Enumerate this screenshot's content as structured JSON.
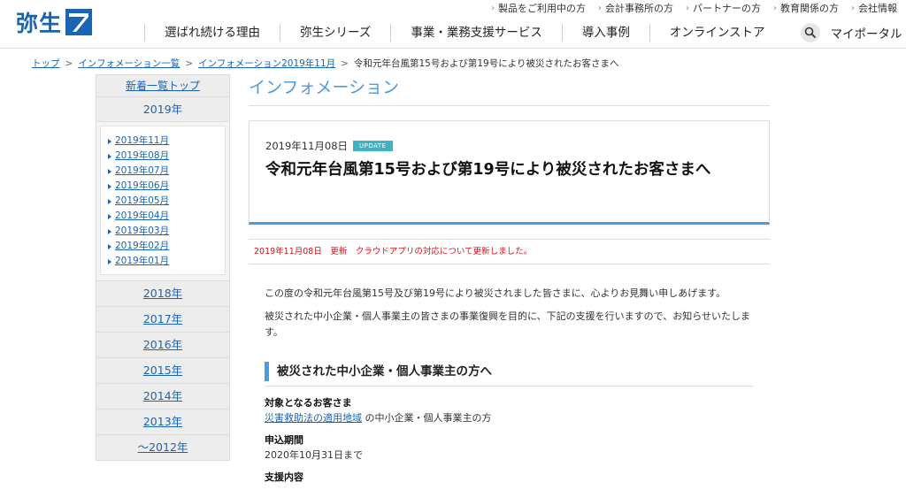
{
  "header": {
    "logo_text": "弥生",
    "utility_links": [
      "製品をご利用中の方",
      "会計事務所の方",
      "パートナーの方",
      "教育関係の方",
      "会社情報"
    ],
    "nav": [
      "選ばれ続ける理由",
      "弥生シリーズ",
      "事業・業務支援サービス",
      "導入事例",
      "オンラインストア"
    ],
    "myportal": "マイポータル"
  },
  "breadcrumb": {
    "items": [
      "トップ",
      "インフォメーション一覧",
      "インフォメーション2019年11月"
    ],
    "current": "令和元年台風第15号および第19号により被災されたお客さまへ"
  },
  "sidebar": {
    "top_link": "新着一覧トップ",
    "current_year": "2019年",
    "months": [
      "2019年11月",
      "2019年08月",
      "2019年07月",
      "2019年06月",
      "2019年05月",
      "2019年04月",
      "2019年03月",
      "2019年02月",
      "2019年01月"
    ],
    "years": [
      "2018年",
      "2017年",
      "2016年",
      "2015年",
      "2014年",
      "2013年",
      "～2012年"
    ]
  },
  "main": {
    "section_title": "インフォメーション",
    "date": "2019年11月08日",
    "badge": "UPDATE",
    "title": "令和元年台風第15号および第19号により被災されたお客さまへ",
    "notice": "2019年11月08日　更新　クラウドアプリの対応について更新しました。",
    "paragraph1": "この度の令和元年台風第15号及び第19号により被災されました皆さまに、心よりお見舞い申しあげます。",
    "paragraph2": "被災された中小企業・個人事業主の皆さまの事業復興を目的に、下記の支援を行いますので、お知らせいたします。",
    "subheading": "被災された中小企業・個人事業主の方へ",
    "target_label": "対象となるお客さま",
    "target_link": "災害救助法の適用地域",
    "target_rest": "の中小企業・個人事業主の方",
    "period_label": "申込期間",
    "period_value": "2020年10月31日まで",
    "support_label": "支援内容"
  },
  "colors": {
    "brand_blue": "#1a64b4",
    "accent_blue": "#4a9be0",
    "badge_teal": "#3fb3c4",
    "notice_red": "#d0151b"
  }
}
